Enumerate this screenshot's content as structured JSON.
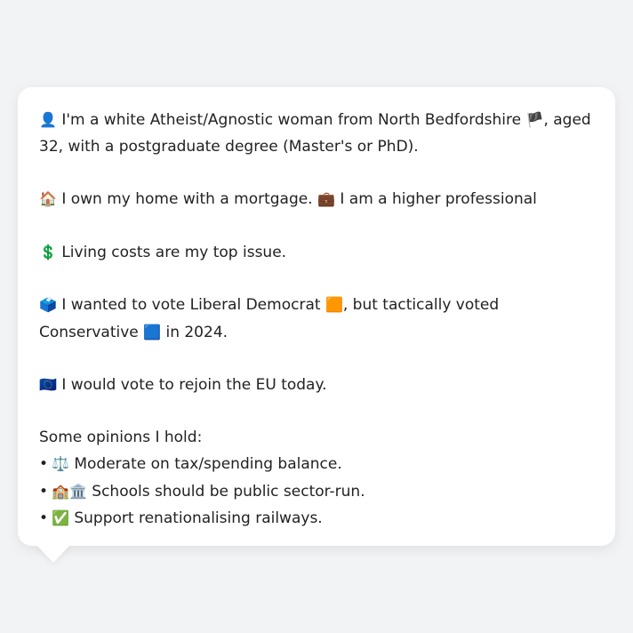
{
  "profile": {
    "identity": {
      "icon": "👤",
      "text_1": " I'm a white Atheist/Agnostic woman from North Bedfordshire ",
      "flag": "🏴",
      "text_2": ", aged 32, with a postgraduate degree (Master's or PhD)."
    },
    "housing": {
      "icon": "🏠",
      "text_1": " I own my home with a mortgage. ",
      "icon_2": "💼",
      "text_2": " I am a higher professional"
    },
    "issue": {
      "icon": "💲",
      "text": " Living costs are my top issue."
    },
    "vote": {
      "icon": "🗳️",
      "text_1": " I wanted to vote Liberal Democrat ",
      "ld_square": "🟧",
      "text_2": ", but tactically voted Conservative ",
      "con_square": "🟦",
      "text_3": " in 2024."
    },
    "eu": {
      "icon": "🇪🇺",
      "text": " I would vote to rejoin the EU today."
    },
    "opinions": {
      "heading": "Some opinions I hold:",
      "bullet_char": "•",
      "items": [
        {
          "icon": "⚖️",
          "text": " Moderate on tax/spending balance."
        },
        {
          "icon": "🏫🏛️",
          "text": " Schools should be public sector-run."
        },
        {
          "icon": "✅",
          "text": " Support renationalising railways."
        }
      ]
    }
  },
  "colors": {
    "background": "#f2f3f5",
    "bubble": "#ffffff",
    "text": "#222222"
  }
}
